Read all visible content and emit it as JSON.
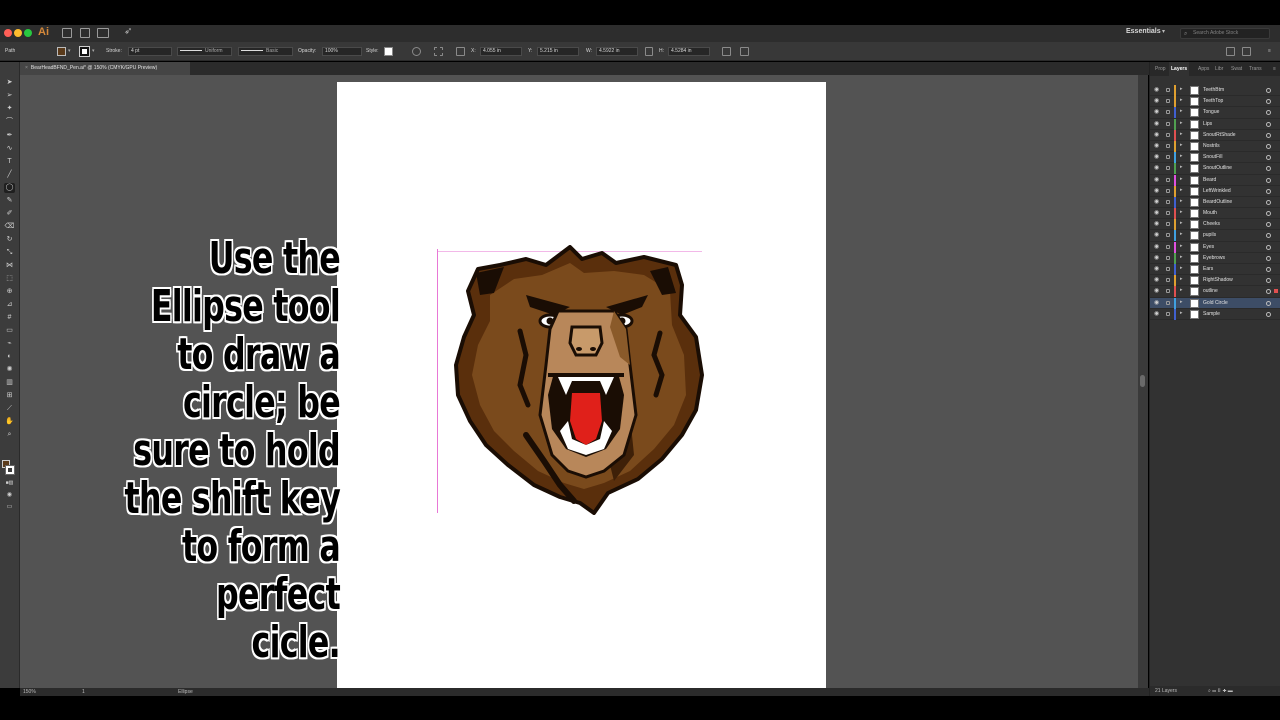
{
  "app": {
    "logo": "Ai",
    "workspace": "Essentials",
    "search_placeholder": "Search Adobe Stock"
  },
  "control_bar": {
    "selection_type": "Path",
    "stroke_label": "Stroke:",
    "stroke_weight": "4 pt",
    "profile": "Uniform",
    "brush": "Basic",
    "opacity_label": "Opacity:",
    "opacity_value": "100%",
    "style_label": "Style:",
    "x_label": "X:",
    "x_value": "4.055 in",
    "y_label": "Y:",
    "y_value": "5.215 in",
    "w_label": "W:",
    "w_value": "4.5922 in",
    "h_label": "H:",
    "h_value": "4.5284 in"
  },
  "document": {
    "tab_title": "BearHeadBFND_Pen.ai* @ 150% (CMYK/GPU Preview)"
  },
  "overlay": {
    "instruction": "Use the Ellipse tool to draw a circle; be sure to hold the shift key to form a perfect cicle."
  },
  "status_bar": {
    "zoom": "150%",
    "artboard": "1",
    "tool": "Ellipse"
  },
  "panel": {
    "tabs": [
      "Prop",
      "Layers",
      "Apps",
      "Libr",
      "Swat",
      "Trans"
    ],
    "active_tab": "Layers",
    "footer": "21 Layers",
    "layers": [
      {
        "name": "TeethBtm",
        "color": "#e0a030"
      },
      {
        "name": "TeethTop",
        "color": "#e0a030"
      },
      {
        "name": "Tongue",
        "color": "#4060d0"
      },
      {
        "name": "Lips",
        "color": "#50a050"
      },
      {
        "name": "SnoutRtShade",
        "color": "#e05050"
      },
      {
        "name": "Nostrils",
        "color": "#e0a030"
      },
      {
        "name": "SnoutFill",
        "color": "#40a0e0"
      },
      {
        "name": "SnoutOutline",
        "color": "#50a050"
      },
      {
        "name": "Beard",
        "color": "#e050e0"
      },
      {
        "name": "LeftWrinkled",
        "color": "#e0a030"
      },
      {
        "name": "BeardOutline",
        "color": "#4060d0"
      },
      {
        "name": "Mouth",
        "color": "#e05050"
      },
      {
        "name": "Cheeks",
        "color": "#e0a030"
      },
      {
        "name": "pupils",
        "color": "#40a0e0"
      },
      {
        "name": "Eyes",
        "color": "#e050e0"
      },
      {
        "name": "Eyebrows",
        "color": "#50a050"
      },
      {
        "name": "Ears",
        "color": "#4060d0"
      },
      {
        "name": "RightShadow",
        "color": "#e0a030"
      },
      {
        "name": "outline",
        "color": "#e05050"
      },
      {
        "name": "Gold Circle",
        "color": "#40a0e0"
      },
      {
        "name": "Sample",
        "color": "#4060d0"
      }
    ]
  }
}
